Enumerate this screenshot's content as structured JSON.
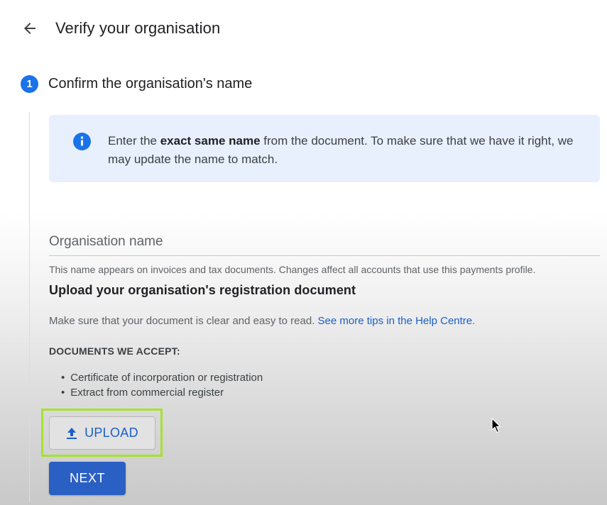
{
  "header": {
    "back_icon": "arrow-left-icon",
    "title": "Verify your organisation"
  },
  "step": {
    "number": "1",
    "title": "Confirm the organisation's name"
  },
  "info": {
    "icon": "info-icon",
    "text_prefix": "Enter the ",
    "text_bold": "exact same name",
    "text_suffix": " from the document. To make sure that we have it right, we may update the name to match."
  },
  "org_name_field": {
    "placeholder": "Organisation name",
    "value": "",
    "helper": "This name appears on invoices and tax documents. Changes affect all accounts that use this payments profile."
  },
  "upload_section": {
    "title": "Upload your organisation's registration document",
    "description": "Make sure that your document is clear and easy to read. ",
    "help_link": "See more tips in the Help Centre",
    "description_end": ".",
    "docs_heading": "DOCUMENTS WE ACCEPT:",
    "docs": [
      "Certificate of incorporation or registration",
      "Extract from commercial register"
    ]
  },
  "buttons": {
    "upload_icon": "upload-icon",
    "upload_label": "UPLOAD",
    "next_label": "NEXT"
  },
  "colors": {
    "primary": "#1a73e8",
    "info_bg": "#e8f0fe",
    "link": "#1a5fc9",
    "next_bg": "#2a5fc4",
    "highlight": "#a6e22e"
  }
}
